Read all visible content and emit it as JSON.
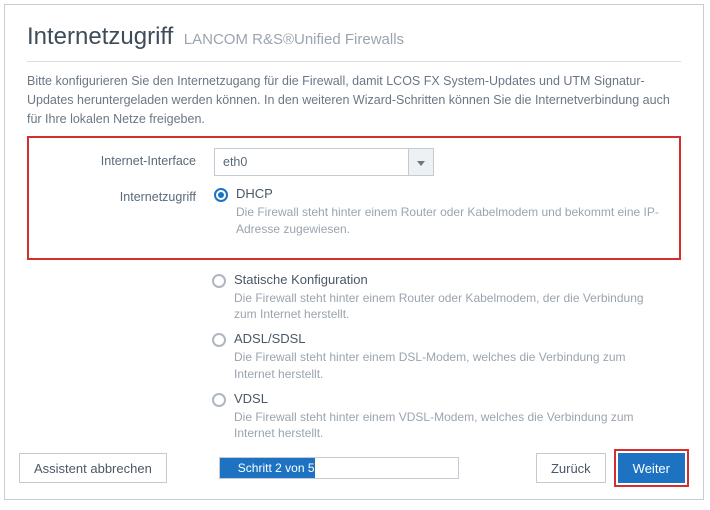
{
  "header": {
    "title": "Internetzugriff",
    "subtitle": "LANCOM R&S®Unified Firewalls"
  },
  "intro": "Bitte konfigurieren Sie den Internetzugang für die Firewall, damit LCOS FX System-Updates und UTM Signatur-Updates heruntergeladen werden können. In den weiteren Wizard-Schritten können Sie die Internetverbindung auch für Ihre lokalen Netze freigeben.",
  "form": {
    "interface_label": "Internet-Interface",
    "interface_value": "eth0",
    "access_label": "Internetzugriff",
    "options": [
      {
        "label": "DHCP",
        "desc": "Die Firewall steht hinter einem Router oder Kabelmodem und bekommt eine IP-Adresse zugewiesen.",
        "selected": true
      },
      {
        "label": "Statische Konfiguration",
        "desc": "Die Firewall steht hinter einem Router oder Kabelmodem, der die Verbindung zum Internet herstellt.",
        "selected": false
      },
      {
        "label": "ADSL/SDSL",
        "desc": "Die Firewall steht hinter einem DSL-Modem, welches die Verbindung zum Internet herstellt.",
        "selected": false
      },
      {
        "label": "VDSL",
        "desc": "Die Firewall steht hinter einem VDSL-Modem, welches die Verbindung zum Internet herstellt.",
        "selected": false
      }
    ]
  },
  "footer": {
    "cancel": "Assistent abbrechen",
    "progress_text": "Schritt 2 von 5",
    "progress_percent": 40,
    "back": "Zurück",
    "next": "Weiter"
  }
}
